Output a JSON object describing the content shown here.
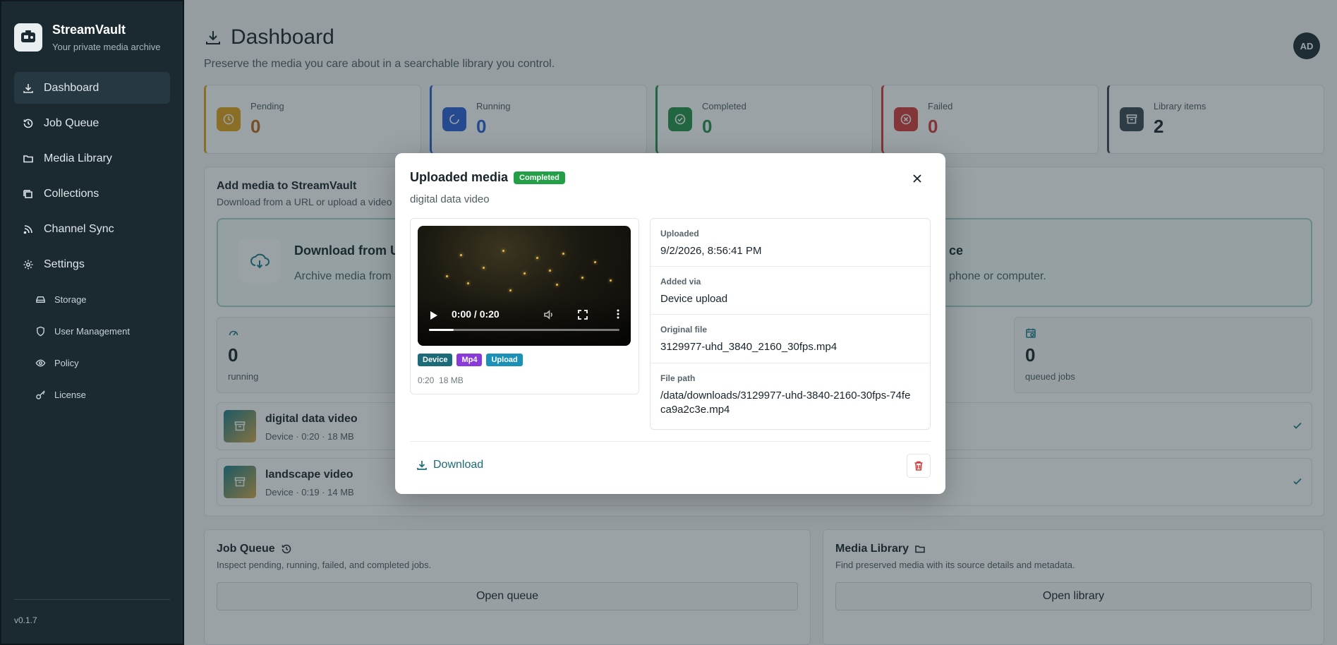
{
  "app": {
    "name": "StreamVault",
    "tagline": "Your private media archive",
    "version": "v0.1.7"
  },
  "sidebar": {
    "items": [
      {
        "label": "Dashboard",
        "icon": "download-icon",
        "active": true
      },
      {
        "label": "Job Queue",
        "icon": "history-icon"
      },
      {
        "label": "Media Library",
        "icon": "folder-icon"
      },
      {
        "label": "Collections",
        "icon": "collections-icon"
      },
      {
        "label": "Channel Sync",
        "icon": "rss-icon"
      },
      {
        "label": "Settings",
        "icon": "gear-icon"
      }
    ],
    "subitems": [
      {
        "label": "Storage",
        "icon": "drive-icon"
      },
      {
        "label": "User Management",
        "icon": "shield-icon"
      },
      {
        "label": "Policy",
        "icon": "eye-icon"
      },
      {
        "label": "License",
        "icon": "key-icon"
      }
    ]
  },
  "header": {
    "title": "Dashboard",
    "subtitle": "Preserve the media you care about in a searchable library you control.",
    "avatar": "AD"
  },
  "stats": [
    {
      "label": "Pending",
      "value": "0",
      "color": "#e0a019",
      "icon": "clock-icon"
    },
    {
      "label": "Running",
      "value": "0",
      "color": "#2b5fd9",
      "icon": "spinner-icon"
    },
    {
      "label": "Completed",
      "value": "0",
      "color": "#23914a",
      "icon": "check-circle-icon"
    },
    {
      "label": "Failed",
      "value": "0",
      "color": "#d43a3a",
      "icon": "x-circle-icon"
    },
    {
      "label": "Library items",
      "value": "2",
      "color": "#3a4750",
      "icon": "archive-icon"
    }
  ],
  "add_media": {
    "title": "Add media to StreamVault",
    "subtitle": "Download from a URL or upload a video",
    "download_title": "Download from U",
    "download_sub": "Archive media from a",
    "device_title": "ce",
    "device_sub": "phone or computer."
  },
  "mini_stats": [
    {
      "value": "0",
      "label": "running"
    },
    {
      "value": "0",
      "label": "queued jobs"
    }
  ],
  "media_rows": [
    {
      "title": "digital data video",
      "meta": "Device · 0:20 · 18 MB"
    },
    {
      "title": "landscape video",
      "meta": "Device · 0:19 · 14 MB"
    }
  ],
  "bottom": {
    "queue": {
      "title": "Job Queue",
      "sub": "Inspect pending, running, failed, and completed jobs.",
      "button": "Open queue"
    },
    "library": {
      "title": "Media Library",
      "sub": "Find preserved media with its source details and metadata.",
      "button": "Open library"
    }
  },
  "modal": {
    "title": "Uploaded media",
    "status": "Completed",
    "subtitle": "digital data video",
    "video": {
      "time": "0:00 / 0:20",
      "progress": 0.13
    },
    "tags": [
      {
        "label": "Device",
        "color": "#1b6b79"
      },
      {
        "label": "Mp4",
        "color": "#8a3ad9"
      },
      {
        "label": "Upload",
        "color": "#1a92b8"
      }
    ],
    "duration": "0:20",
    "size": "18 MB",
    "details": [
      {
        "label": "Uploaded",
        "value": "9/2/2026, 8:56:41 PM"
      },
      {
        "label": "Added via",
        "value": "Device upload"
      },
      {
        "label": "Original file",
        "value": "3129977-uhd_3840_2160_30fps.mp4"
      },
      {
        "label": "File path",
        "value": "/data/downloads/3129977-uhd-3840-2160-30fps-74feca9a2c3e.mp4"
      }
    ],
    "download_label": "Download"
  }
}
